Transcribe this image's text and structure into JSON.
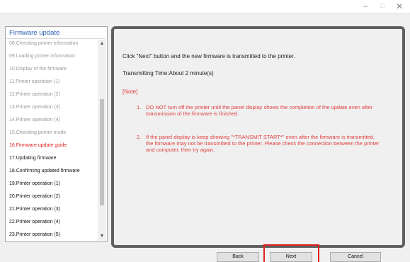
{
  "window": {
    "minimize_glyph": "–",
    "maximize_glyph": "□",
    "close_glyph": "✕"
  },
  "sidebar": {
    "header": "Firmware update",
    "items": [
      {
        "label": "08.Checking printer information",
        "state": "done"
      },
      {
        "label": "09.Loading printer information",
        "state": "done"
      },
      {
        "label": "10.Display of the firmware",
        "state": "done"
      },
      {
        "label": "11.Printer operation (1)",
        "state": "done"
      },
      {
        "label": "12.Printer operation (2)",
        "state": "done"
      },
      {
        "label": "13.Printer operation (3)",
        "state": "done"
      },
      {
        "label": "14.Printer operation (4)",
        "state": "done"
      },
      {
        "label": "15.Checking printer mode",
        "state": "done"
      },
      {
        "label": "16.Firmware update guide",
        "state": "current"
      },
      {
        "label": "17.Updating firmware",
        "state": "todo"
      },
      {
        "label": "18.Confirming updated firmware",
        "state": "todo"
      },
      {
        "label": "19.Printer operation (1)",
        "state": "todo"
      },
      {
        "label": "20.Printer operation (2)",
        "state": "todo"
      },
      {
        "label": "21.Printer operation (3)",
        "state": "todo"
      },
      {
        "label": "22.Printer operation (4)",
        "state": "todo"
      },
      {
        "label": "23.Printer operation (5)",
        "state": "todo"
      }
    ],
    "scroll_up_glyph": "▲",
    "scroll_down_glyph": "▼"
  },
  "main": {
    "instruction": "Click \"Next\" button and the new firmware is transmitted to the printer.",
    "transmitting_time": "Transmitting Time:About 2 minute(s)",
    "note_heading": "[Note]",
    "notes": [
      {
        "num": "1.",
        "text": "DO NOT turn off the printer until the panel display shows the completion of the update even after transmission of the firmware is finished."
      },
      {
        "num": "2.",
        "text": "If the panel display is keep showing \"*TRANSMIT START*\" even after the firmware is transmitted, the firmware may not be transmitted to the printer. Please check the connection between the printer and computer, then try again."
      }
    ]
  },
  "buttons": {
    "back": "Back",
    "next": "Next",
    "cancel": "Cancel"
  },
  "colors": {
    "current_step": "#e02020",
    "note": "#e04040",
    "done_step": "#9a9a9a",
    "highlight": "#e02020"
  }
}
